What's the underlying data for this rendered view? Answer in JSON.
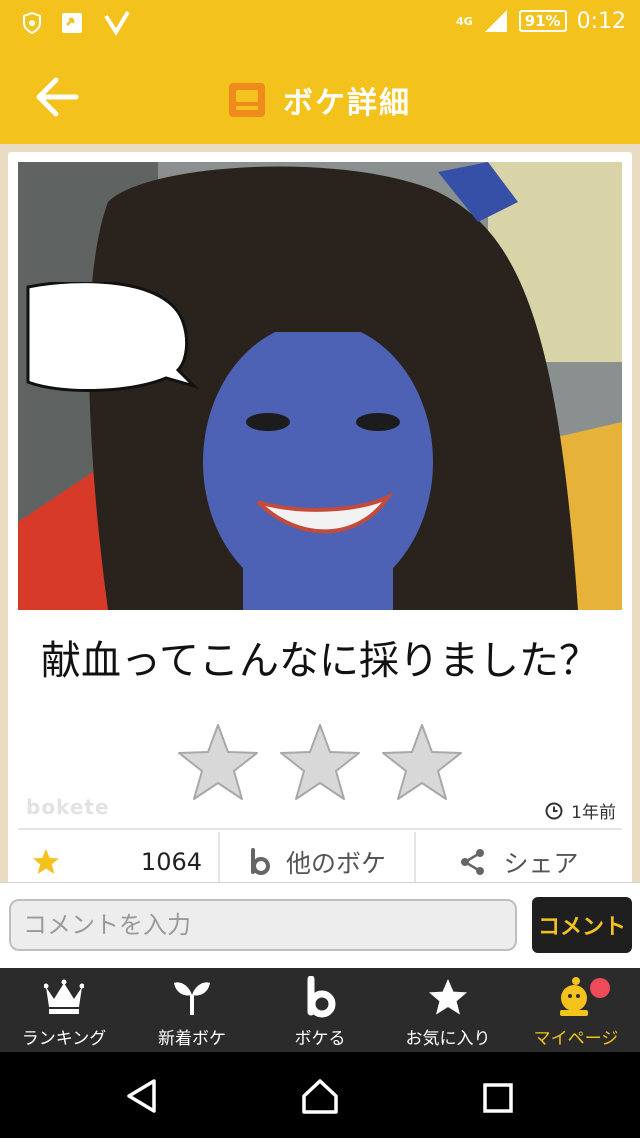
{
  "status_bar": {
    "network": "4G",
    "battery": "91%",
    "time": "0:12"
  },
  "app_bar": {
    "title": "ボケ詳細"
  },
  "post": {
    "caption": "献血ってこんなに採りました？",
    "watermark": "bokete",
    "time_ago": "1年前",
    "score": "1064",
    "other_bokes_label": "他のボケ",
    "share_label": "シェア"
  },
  "comment": {
    "placeholder": "コメントを入力",
    "submit_label": "コメント"
  },
  "bottom_nav": {
    "items": [
      {
        "label": "ランキング",
        "icon": "crown-icon"
      },
      {
        "label": "新着ボケ",
        "icon": "sprout-icon"
      },
      {
        "label": "ボケる",
        "icon": "bokete-b-icon"
      },
      {
        "label": "お気に入り",
        "icon": "star-icon"
      },
      {
        "label": "マイページ",
        "icon": "mascot-icon"
      }
    ],
    "active_index": 4
  },
  "colors": {
    "brand_yellow": "#f3c21c",
    "nav_dark": "#2b2b2b",
    "badge_red": "#ee4b5a"
  }
}
